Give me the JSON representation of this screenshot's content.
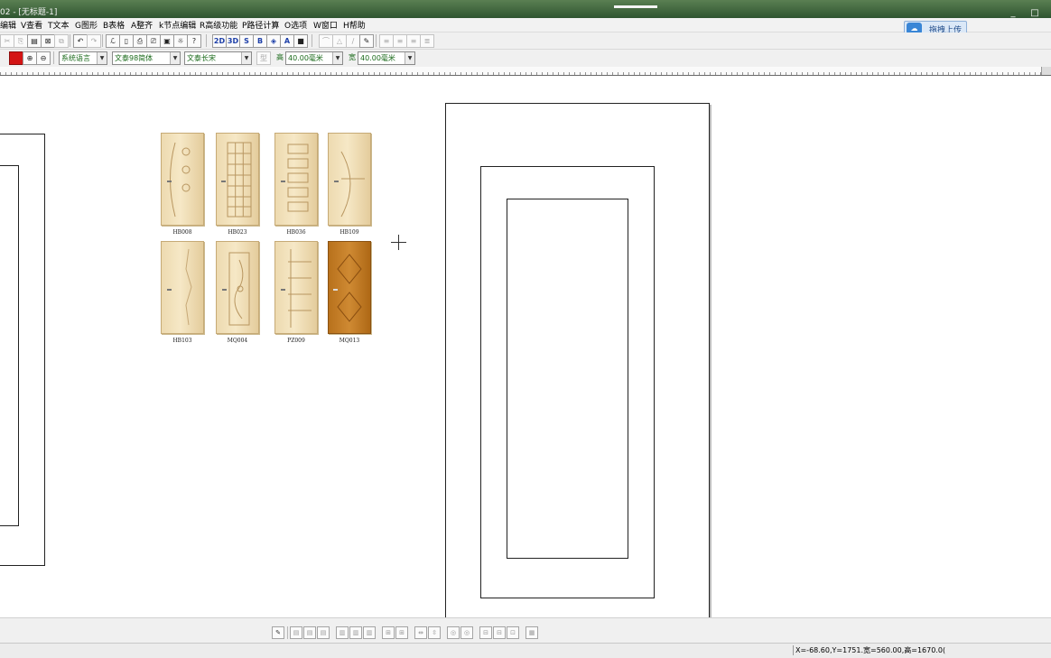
{
  "window": {
    "title": "02 - [无标题-1]",
    "controls": [
      "_",
      "□",
      "✕"
    ]
  },
  "menu": [
    {
      "label": "编辑"
    },
    {
      "label": "V查看"
    },
    {
      "label": "T文本"
    },
    {
      "label": "G图形"
    },
    {
      "label": "B表格"
    },
    {
      "label": "A整齐"
    },
    {
      "label": "k节点编辑"
    },
    {
      "label": "R高级功能"
    },
    {
      "label": "P路径计算"
    },
    {
      "label": "O选项"
    },
    {
      "label": "W窗口"
    },
    {
      "label": "H帮助"
    }
  ],
  "upload_button": {
    "label": "拖拽上传",
    "icon": "cloud-upload-icon"
  },
  "toolbar1": {
    "view_2d": "2D",
    "view_3d": "3D"
  },
  "toolbar2": {
    "font_lang": "系统语言",
    "font_name": "文泰98简体",
    "font_style": "文泰长宋",
    "height_label": "高",
    "height_value": "40.00毫米",
    "width_label": "宽",
    "width_value": "40.00毫米"
  },
  "doors": [
    {
      "code": "HB008",
      "style": "circles"
    },
    {
      "code": "HB023",
      "style": "grid"
    },
    {
      "code": "HB036",
      "style": "panels"
    },
    {
      "code": "HB109",
      "style": "arc"
    },
    {
      "code": "HB103",
      "style": "plain"
    },
    {
      "code": "MQ004",
      "style": "carved"
    },
    {
      "code": "PZ009",
      "style": "stripes"
    },
    {
      "code": "MQ013",
      "style": "diamond",
      "dark": true
    }
  ],
  "status": {
    "coords": "X=-68.60,Y=1751.",
    "size": "宽=560.00,高=1670.0("
  }
}
